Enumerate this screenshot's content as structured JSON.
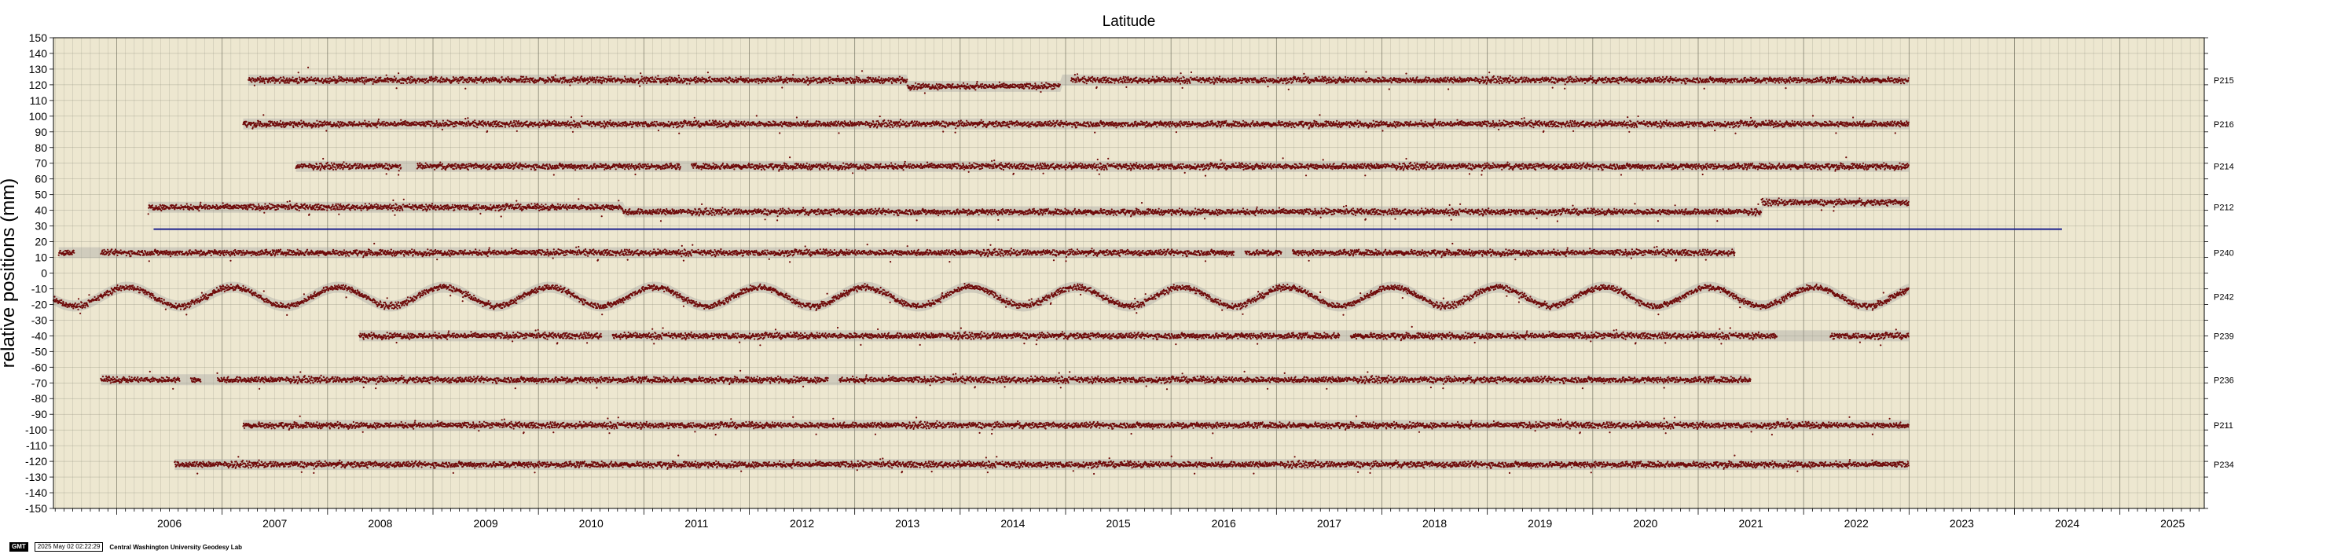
{
  "chart_data": {
    "type": "scatter",
    "title": "Latitude",
    "ylabel": "relative positions (mm)",
    "xlabel": "",
    "xlim": [
      2005.4,
      2025.8
    ],
    "ylim": [
      -150,
      150
    ],
    "ytick_step": 10,
    "x_tick_labels": [
      "2006",
      "2007",
      "2008",
      "2009",
      "2010",
      "2011",
      "2012",
      "2013",
      "2014",
      "2015",
      "2016",
      "2017",
      "2018",
      "2019",
      "2020",
      "2021",
      "2022",
      "2023",
      "2024",
      "2025"
    ],
    "grid": true,
    "background_color": "#ede7d0",
    "point_color": "#6e0a0a",
    "envelope_color": "#9a9a9a",
    "reference_line": {
      "x0": 2006.35,
      "x1": 2024.45,
      "y": 28,
      "color": "#1a1f8c"
    },
    "series": [
      {
        "name": "P215",
        "offset": 123,
        "start": 2007.25,
        "end": 2023.0,
        "gaps": [
          [
            2014.95,
            2015.05
          ]
        ],
        "segments": [
          {
            "from": 2013.5,
            "to": 2014.95,
            "shift": -4
          }
        ]
      },
      {
        "name": "P216",
        "offset": 95,
        "start": 2007.2,
        "end": 2023.0,
        "gaps": []
      },
      {
        "name": "P214",
        "offset": 68,
        "start": 2007.7,
        "end": 2023.0,
        "gaps": [
          [
            2008.7,
            2008.85
          ],
          [
            2011.35,
            2011.45
          ]
        ]
      },
      {
        "name": "P212",
        "offset": 42,
        "start": 2006.3,
        "end": 2023.0,
        "gaps": [],
        "segments": [
          {
            "from": 2010.8,
            "to": 2021.6,
            "shift": -3
          },
          {
            "from": 2021.6,
            "to": 2023.0,
            "shift": 3
          }
        ]
      },
      {
        "name": "P240",
        "offset": 13,
        "start": 2005.45,
        "end": 2021.35,
        "gaps": [
          [
            2005.6,
            2005.85
          ],
          [
            2016.6,
            2016.7
          ],
          [
            2017.05,
            2017.15
          ]
        ]
      },
      {
        "name": "P242",
        "offset": -15,
        "start": 2005.4,
        "end": 2023.0,
        "gaps": [],
        "seasonal": 6
      },
      {
        "name": "P239",
        "offset": -40,
        "start": 2008.3,
        "end": 2023.0,
        "gaps": [
          [
            2010.6,
            2010.7
          ],
          [
            2017.6,
            2017.7
          ],
          [
            2021.75,
            2022.25
          ]
        ]
      },
      {
        "name": "P236",
        "offset": -68,
        "start": 2005.85,
        "end": 2021.5,
        "gaps": [
          [
            2006.6,
            2006.7
          ],
          [
            2006.8,
            2006.95
          ],
          [
            2012.75,
            2012.85
          ]
        ]
      },
      {
        "name": "P211",
        "offset": -97,
        "start": 2007.2,
        "end": 2023.0,
        "gaps": []
      },
      {
        "name": "P234",
        "offset": -122,
        "start": 2006.55,
        "end": 2023.0,
        "gaps": []
      }
    ]
  },
  "footer": {
    "badge": "GMT",
    "timestamp": "2025 May 02 02:22:29",
    "lab": "Central Washington University Geodesy Lab"
  }
}
